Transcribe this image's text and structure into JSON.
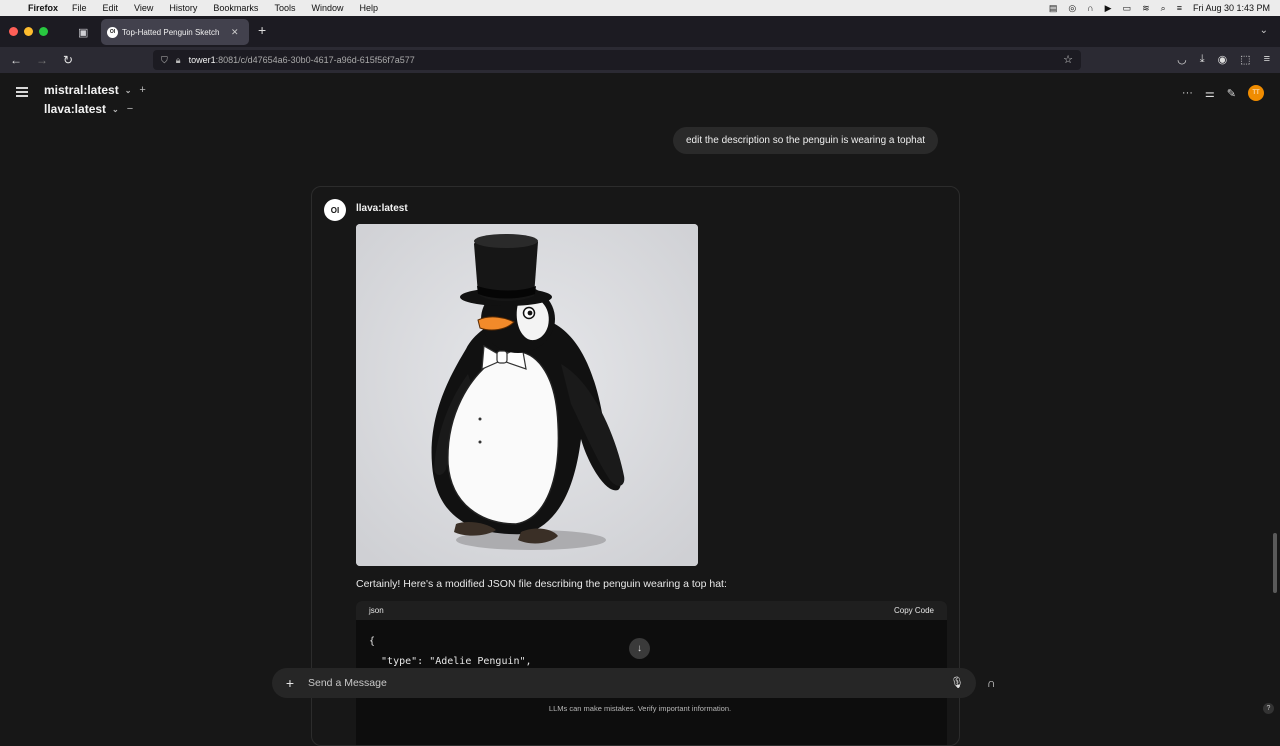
{
  "menubar": {
    "app_name": "Firefox",
    "menus": [
      "File",
      "Edit",
      "View",
      "History",
      "Bookmarks",
      "Tools",
      "Window",
      "Help"
    ],
    "datetime": "Fri Aug 30  1:43 PM"
  },
  "tab": {
    "title": "Top-Hatted Penguin Sketch",
    "favicon_text": "OI"
  },
  "url": {
    "host": "tower1",
    "path": ":8081/c/d47654a6-30b0-4617-a96d-615f56f7a577"
  },
  "header": {
    "models": [
      {
        "name": "mistral:latest",
        "action": "+"
      },
      {
        "name": "llava:latest",
        "action": "−"
      }
    ],
    "avatar_initials": "TT"
  },
  "chat": {
    "user_message": "edit the description so the penguin is wearing a tophat",
    "assistant": {
      "avatar_text": "OI",
      "model_name": "llava:latest",
      "response_text": "Certainly! Here's a modified JSON file describing the penguin wearing a top hat:",
      "code": {
        "language": "json",
        "copy_label": "Copy Code",
        "lines": [
          "{",
          "  \"type\": \"Adelie Penguin\","
        ]
      }
    }
  },
  "composer": {
    "placeholder": "Send a Message"
  },
  "footer": {
    "disclaimer": "LLMs can make mistakes. Verify important information.",
    "help": "?"
  },
  "colors": {
    "accent": "#f08c00",
    "background": "#171717"
  }
}
